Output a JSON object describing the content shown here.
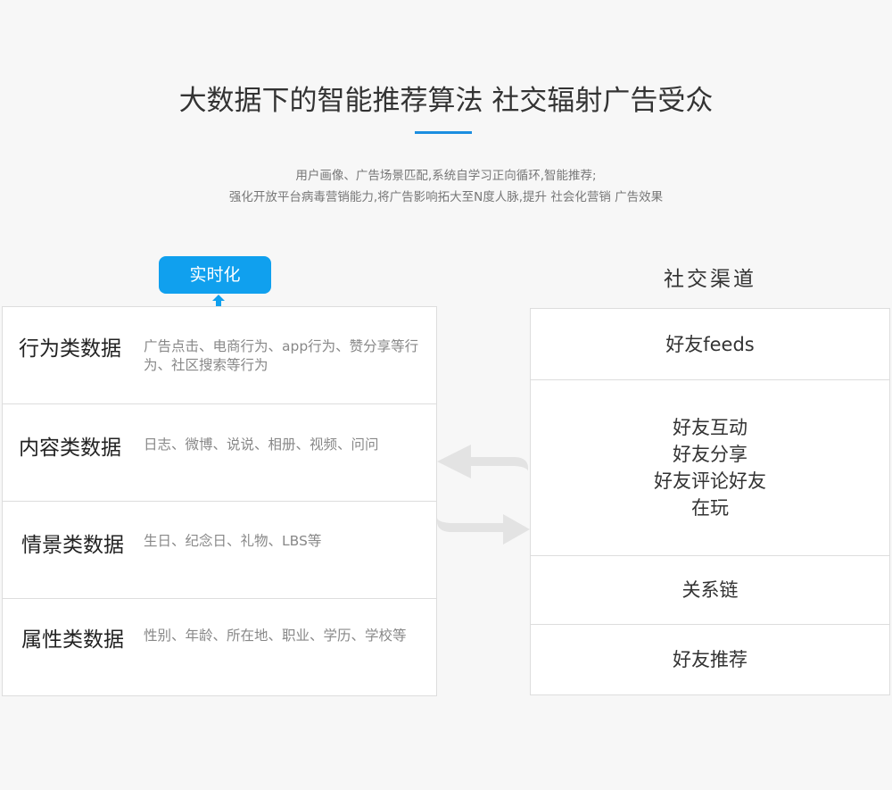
{
  "header": {
    "title": "大数据下的智能推荐算法 社交辐射广告受众",
    "intro_line_1": "用户画像、广告场景匹配,系统自学习正向循环,智能推荐;",
    "intro_line_2": "强化开放平台病毒营销能力,将广告影响拓大至N度人脉,提升 社会化营销 广告效果"
  },
  "realtime_badge": {
    "label": "实时化"
  },
  "data_sources": [
    {
      "title": "行为类数据",
      "desc": "广告点击、电商行为、app行为、赞分享等行为、社区搜索等行为"
    },
    {
      "title": "内容类数据",
      "desc": "日志、微博、说说、相册、视频、问问"
    },
    {
      "title": "情景类数据",
      "desc": "生日、纪念日、礼物、LBS等"
    },
    {
      "title": "属性类数据",
      "desc": "性别、年龄、所在地、职业、学历、学校等"
    }
  ],
  "social_channels": {
    "heading": "社交渠道",
    "items": [
      {
        "lines": [
          "好友feeds"
        ]
      },
      {
        "lines": [
          "好友互动",
          "好友分享",
          "好友评论好友",
          "在玩"
        ]
      },
      {
        "lines": [
          "关系链"
        ]
      },
      {
        "lines": [
          "好友推荐"
        ]
      }
    ]
  },
  "colors": {
    "accent_blue": "#10a0ee",
    "underline_blue": "#1b8ee0",
    "arrow_gray": "#e3e3e3"
  },
  "icons": {
    "badge_arrow": "arrow-up-icon",
    "exchange": "exchange-arrows-icon"
  }
}
